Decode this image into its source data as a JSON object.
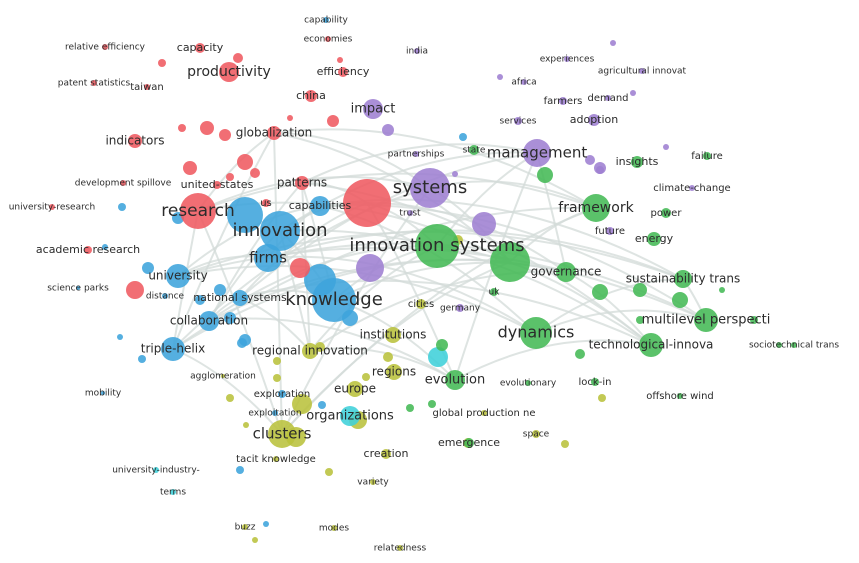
{
  "clusters": {
    "red": "#ef5a61",
    "blue": "#3ea4dc",
    "green": "#44b955",
    "purple": "#9e80d1",
    "yellow": "#b9c23c",
    "cyan": "#3fd0d9"
  },
  "nodes": [
    {
      "label": "relative efficiency",
      "cluster": "red"
    },
    {
      "label": "capacity",
      "cluster": "red"
    },
    {
      "label": "productivity",
      "cluster": "red"
    },
    {
      "label": "patent statistics",
      "cluster": "red"
    },
    {
      "label": "taiwan",
      "cluster": "red"
    },
    {
      "label": "efficiency",
      "cluster": "red"
    },
    {
      "label": "china",
      "cluster": "red"
    },
    {
      "label": "globalization",
      "cluster": "red"
    },
    {
      "label": "indicators",
      "cluster": "red"
    },
    {
      "label": "development spillove",
      "cluster": "red"
    },
    {
      "label": "united-states",
      "cluster": "red"
    },
    {
      "label": "patterns",
      "cluster": "red"
    },
    {
      "label": "research",
      "cluster": "red"
    },
    {
      "label": "us",
      "cluster": "red"
    },
    {
      "label": "academic research",
      "cluster": "red"
    },
    {
      "label": "economies",
      "cluster": "red"
    },
    {
      "label": "university-research",
      "cluster": "red"
    },
    {
      "label": "capability",
      "cluster": "blue"
    },
    {
      "label": "innovation",
      "cluster": "blue"
    },
    {
      "label": "capabilities",
      "cluster": "blue"
    },
    {
      "label": "firms",
      "cluster": "blue"
    },
    {
      "label": "knowledge",
      "cluster": "blue"
    },
    {
      "label": "university",
      "cluster": "blue"
    },
    {
      "label": "science parks",
      "cluster": "blue"
    },
    {
      "label": "distance",
      "cluster": "blue"
    },
    {
      "label": "national systems",
      "cluster": "blue"
    },
    {
      "label": "collaboration",
      "cluster": "blue"
    },
    {
      "label": "triple-helix",
      "cluster": "blue"
    },
    {
      "label": "exploration",
      "cluster": "blue"
    },
    {
      "label": "exploitation",
      "cluster": "blue"
    },
    {
      "label": "mobility",
      "cluster": "blue"
    },
    {
      "label": "university-industry-",
      "cluster": "cyan"
    },
    {
      "label": "terms",
      "cluster": "cyan"
    },
    {
      "label": "impact",
      "cluster": "purple"
    },
    {
      "label": "systems",
      "cluster": "purple"
    },
    {
      "label": "trust",
      "cluster": "purple"
    },
    {
      "label": "india",
      "cluster": "purple"
    },
    {
      "label": "experiences",
      "cluster": "purple"
    },
    {
      "label": "agricultural innovat",
      "cluster": "purple"
    },
    {
      "label": "africa",
      "cluster": "purple"
    },
    {
      "label": "farmers",
      "cluster": "purple"
    },
    {
      "label": "demand",
      "cluster": "purple"
    },
    {
      "label": "services",
      "cluster": "purple"
    },
    {
      "label": "adoption",
      "cluster": "purple"
    },
    {
      "label": "management",
      "cluster": "purple"
    },
    {
      "label": "partnerships",
      "cluster": "purple"
    },
    {
      "label": "germany",
      "cluster": "purple"
    },
    {
      "label": "climate-change",
      "cluster": "purple"
    },
    {
      "label": "future",
      "cluster": "purple"
    },
    {
      "label": "state",
      "cluster": "green"
    },
    {
      "label": "framework",
      "cluster": "green"
    },
    {
      "label": "insights",
      "cluster": "green"
    },
    {
      "label": "failure",
      "cluster": "green"
    },
    {
      "label": "power",
      "cluster": "green"
    },
    {
      "label": "energy",
      "cluster": "green"
    },
    {
      "label": "innovation systems",
      "cluster": "green"
    },
    {
      "label": "governance",
      "cluster": "green"
    },
    {
      "label": "sustainability trans",
      "cluster": "green"
    },
    {
      "label": "multilevel perspecti",
      "cluster": "green"
    },
    {
      "label": "technological-innova",
      "cluster": "green"
    },
    {
      "label": "dynamics",
      "cluster": "green"
    },
    {
      "label": "uk",
      "cluster": "green"
    },
    {
      "label": "sociotechnical trans",
      "cluster": "green"
    },
    {
      "label": "evolution",
      "cluster": "green"
    },
    {
      "label": "evolutionary",
      "cluster": "green"
    },
    {
      "label": "lock-in",
      "cluster": "green"
    },
    {
      "label": "offshore wind",
      "cluster": "green"
    },
    {
      "label": "emergence",
      "cluster": "green"
    },
    {
      "label": "global production ne",
      "cluster": "yellow"
    },
    {
      "label": "institutions",
      "cluster": "yellow"
    },
    {
      "label": "regional innovation",
      "cluster": "yellow"
    },
    {
      "label": "regions",
      "cluster": "yellow"
    },
    {
      "label": "europe",
      "cluster": "yellow"
    },
    {
      "label": "organizations",
      "cluster": "cyan"
    },
    {
      "label": "clusters",
      "cluster": "yellow"
    },
    {
      "label": "creation",
      "cluster": "yellow"
    },
    {
      "label": "tacit knowledge",
      "cluster": "yellow"
    },
    {
      "label": "variety",
      "cluster": "yellow"
    },
    {
      "label": "agglomeration",
      "cluster": "yellow"
    },
    {
      "label": "space",
      "cluster": "yellow"
    },
    {
      "label": "buzz",
      "cluster": "yellow"
    },
    {
      "label": "modes",
      "cluster": "yellow"
    },
    {
      "label": "relatedness",
      "cluster": "yellow"
    },
    {
      "label": "cities",
      "cluster": "yellow"
    }
  ]
}
